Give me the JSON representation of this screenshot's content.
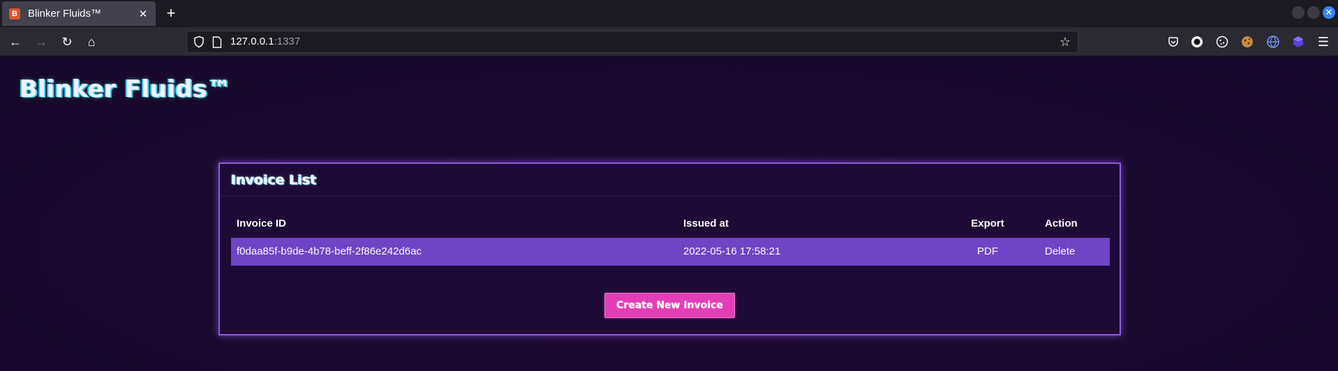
{
  "browser": {
    "tab_title": "Blinker Fluids™",
    "tab_close_glyph": "✕",
    "new_tab_glyph": "+",
    "url_host": "127.0.0.1",
    "url_port": ":1337",
    "back_glyph": "←",
    "forward_glyph": "→",
    "reload_glyph": "↻",
    "home_glyph": "⌂",
    "star_glyph": "☆",
    "close_window_glyph": "✕"
  },
  "page": {
    "brand": "Blinker Fluids™",
    "card_title": "Invoice List",
    "table": {
      "headers": [
        "Invoice ID",
        "Issued at",
        "Export",
        "Action"
      ],
      "rows": [
        {
          "id": "f0daa85f-b9de-4b78-beff-2f86e242d6ac",
          "issued_at": "2022-05-16 17:58:21",
          "export": "PDF",
          "action": "Delete"
        }
      ]
    },
    "create_button": "Create New Invoice"
  },
  "colors": {
    "page_bg": "#1a0a2e",
    "card_border": "#8d5be0",
    "row_highlight": "#6e45c6",
    "button_bg": "#e33eb8",
    "title_glow": "#37d0e6"
  }
}
